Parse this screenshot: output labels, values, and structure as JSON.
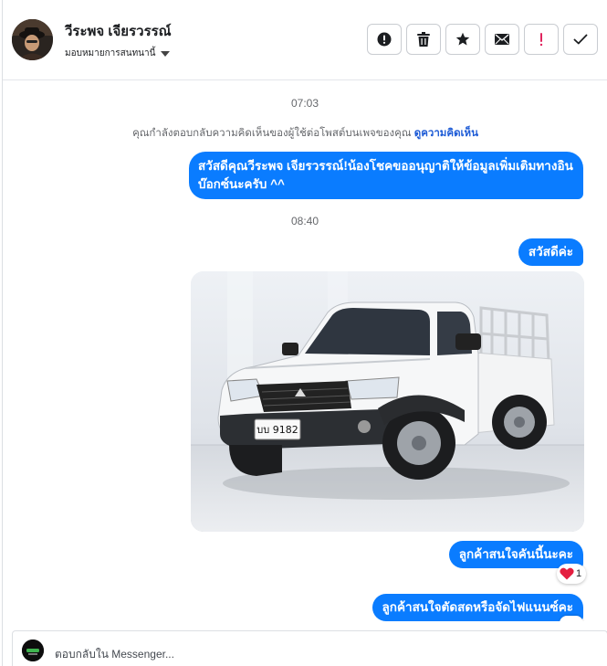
{
  "header": {
    "user_name": "วีระพจ เจียรวรรณ์",
    "assign_label": "มอบหมายการสนทนานี้",
    "actions": [
      {
        "name": "report-spam-icon",
        "color": "#1c1e21"
      },
      {
        "name": "trash-icon",
        "color": "#1c1e21"
      },
      {
        "name": "star-icon",
        "color": "#1c1e21"
      },
      {
        "name": "mail-icon",
        "color": "#1c1e21"
      },
      {
        "name": "exclamation-icon",
        "color": "#e0245e"
      },
      {
        "name": "checkmark-icon",
        "color": "#1c1e21"
      }
    ]
  },
  "conversation": {
    "time_1": "07:03",
    "system_note": "คุณกำลังตอบกลับความคิดเห็นของผู้ใช้ต่อโพสต์บนเพจของคุณ",
    "system_note_link": "ดูความคิดเห็น",
    "message_1": "สวัสดีคุณวีระพจ เจียรวรรณ์!น้องโชคขออนุญาติให้ข้อมูลเพิ่มเติมทางอินบ๊อกซ์นะครับ ^^",
    "time_2": "08:40",
    "message_2": "สวัสดีค่ะ",
    "photo_plate": "บบ 9182",
    "message_3": "ลูกค้าสนใจคันนี้นะคะ",
    "reaction_count": "1",
    "message_4": "ลูกค้าสนใจตัดสดหรือจัดไฟแนนซ์คะ"
  },
  "composer": {
    "placeholder": "ตอบกลับใน Messenger..."
  },
  "colors": {
    "bubble": "#0a7cff",
    "link": "#1d5bd6",
    "danger": "#e0245e"
  }
}
